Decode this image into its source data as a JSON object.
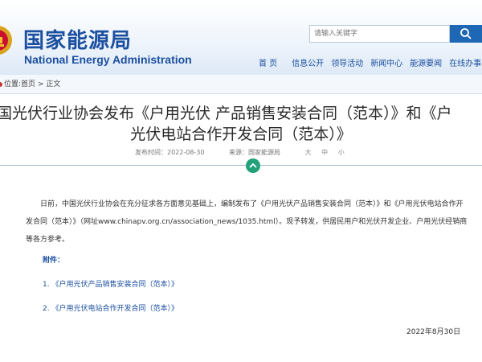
{
  "header": {
    "title_cn": "国家能源局",
    "title_en": "National Energy Administration",
    "search_placeholder": "请输入关键字"
  },
  "nav": [
    "首 页",
    "信息公开",
    "领导活动",
    "新闻中心",
    "能源要闻",
    "在线办事"
  ],
  "breadcrumb": {
    "prefix": "位置:",
    "home": "首页",
    "sep": " > ",
    "current": "正文"
  },
  "article": {
    "title_line1": "国光伏行业协会发布《户用光伏 产品销售安装合同（范本）》和《户",
    "title_line2": "光伏电站合作开发合同（范本）》",
    "date": "发布时间：2022-08-30",
    "source": "来源：国家能源局",
    "font_sizes": [
      "大",
      "中",
      "小"
    ],
    "paragraph": "日前，中国光伏行业协会在充分征求各方面意见基础上，编制发布了《户用光伏产品销售安装合同（范本）》和《户用光伏电站合作开发合同（范本）》（网址www.chinapv.org.cn/association_news/1035.html）。现予转发，供居民用户和光伏开发企业、户用光伏经销商等各方参考。",
    "attachments_label": "附件：",
    "attachments": [
      "1. 《户用光伏产品销售安装合同（范本）》",
      "2. 《户用光伏电站合作开发合同（范本）》"
    ],
    "sign_date": "2022年8月30日"
  },
  "colors": {
    "brand_blue": "#1b4fa0",
    "search_button": "#1d67b5",
    "toggle_green": "#22a17b"
  }
}
